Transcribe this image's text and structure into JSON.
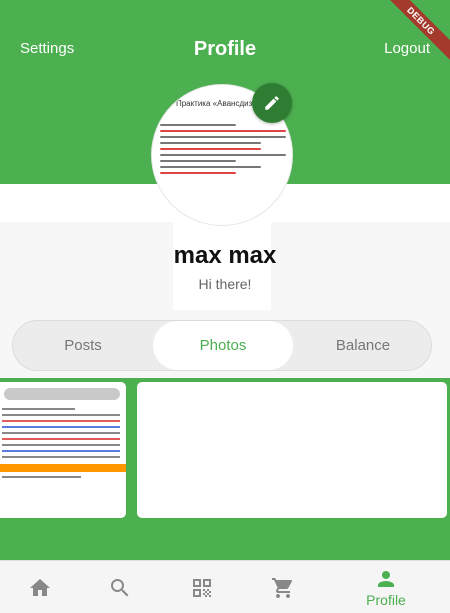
{
  "header": {
    "settings_label": "Settings",
    "title": "Profile",
    "logout_label": "Logout",
    "debug_banner": "DEBUG"
  },
  "avatar": {
    "image_title": "Практика «Авансдизайн»"
  },
  "profile": {
    "name": "max max",
    "bio": "Hi there!"
  },
  "tabs": [
    {
      "label": "Posts",
      "selected": false
    },
    {
      "label": "Photos",
      "selected": true
    },
    {
      "label": "Balance",
      "selected": false
    }
  ],
  "bottom_nav": {
    "items": [
      {
        "icon": "home-icon",
        "label": "",
        "selected": false
      },
      {
        "icon": "search-icon",
        "label": "",
        "selected": false
      },
      {
        "icon": "qr-code-icon",
        "label": "",
        "selected": false
      },
      {
        "icon": "cart-icon",
        "label": "",
        "selected": false
      },
      {
        "icon": "person-icon",
        "label": "Profile",
        "selected": true
      }
    ]
  },
  "colors": {
    "primary": "#4caf50",
    "primary_dark": "#2e7d32",
    "debug_banner": "#a33a2b",
    "inactive_icon": "#888888"
  }
}
